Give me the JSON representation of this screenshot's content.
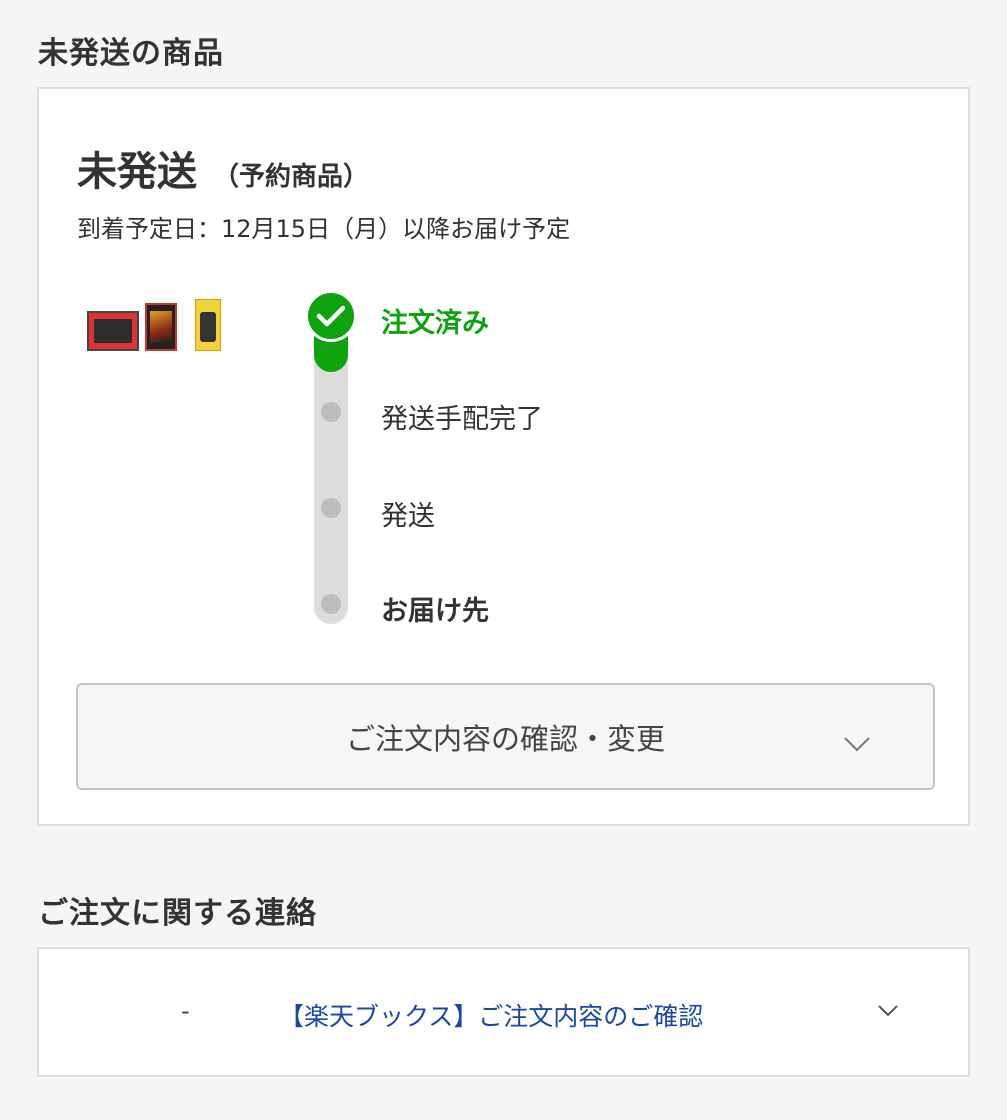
{
  "unshipped": {
    "heading": "未発送の商品",
    "status": "未発送",
    "status_note": "（予約商品）",
    "delivery": "到着予定日：12月15日（月）以降お届け予定",
    "steps": [
      "注文済み",
      "発送手配完了",
      "発送",
      "お届け先"
    ],
    "current_step": 1,
    "accent_color": "#0fa30f",
    "detail_button": "ご注文内容の確認・変更"
  },
  "contact": {
    "heading": "ご注文に関する連絡",
    "messages": [
      {
        "sender": "-",
        "subject": "【楽天ブックス】ご注文内容のご確認"
      }
    ]
  }
}
